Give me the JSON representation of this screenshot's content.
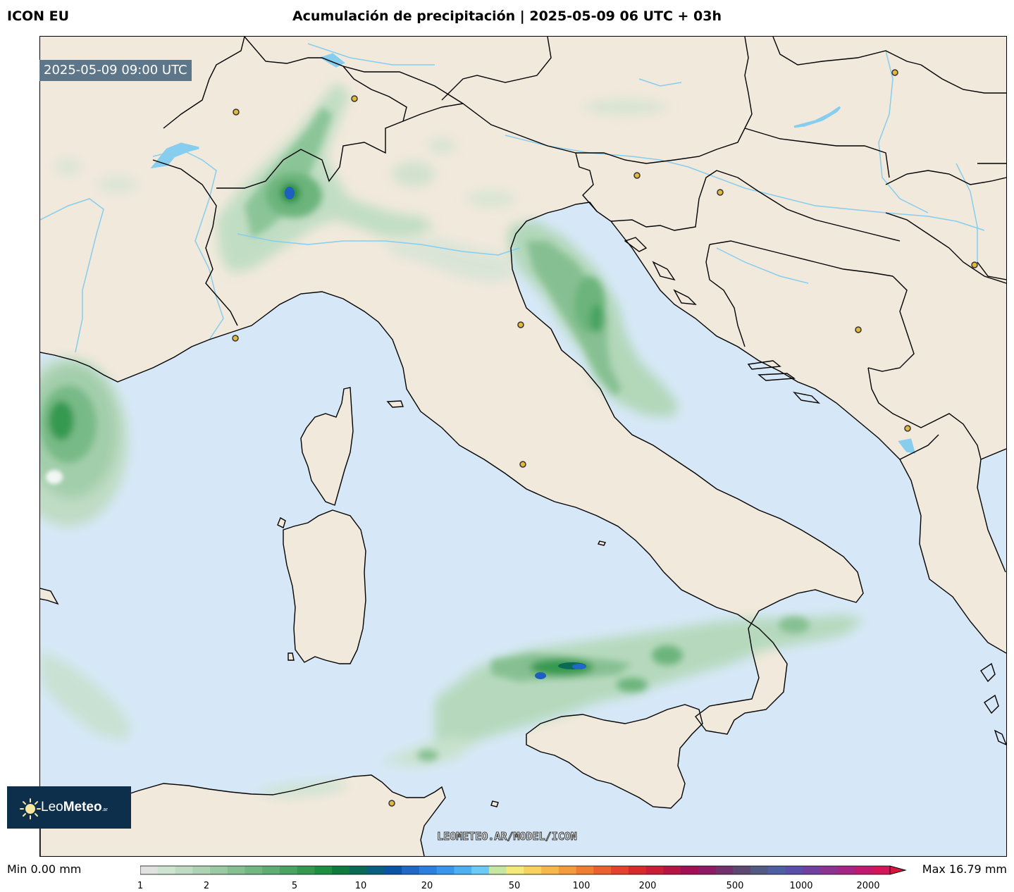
{
  "header": {
    "model": "ICON EU",
    "title": "Acumulación de precipitación | 2025-05-09 06 UTC + 03h"
  },
  "map": {
    "valid_time": "2025-05-09 09:00 UTC",
    "watermark": "LEOMETEO.AR/MODEL/ICON",
    "colors": {
      "sea": "#d6e8f7",
      "land": "#f1e9dc",
      "rivers": "#86cdee",
      "coastline": "#000000",
      "city_marker": "#e2b93b"
    }
  },
  "logo": {
    "name_light": "Leo",
    "name_bold": "Meteo",
    "suffix": ".ar",
    "icon": "sun-icon"
  },
  "legend": {
    "min_label": "Min 0.00 mm",
    "max_label": "Max 16.79 mm",
    "ticks": [
      "1",
      "2",
      "5",
      "10",
      "20",
      "50",
      "100",
      "200",
      "500",
      "1000",
      "2000"
    ],
    "colors": [
      "#dfe2df",
      "#cfe3d1",
      "#bfdcc3",
      "#add3b3",
      "#9acaa3",
      "#86c092",
      "#72b782",
      "#5fad72",
      "#4aa362",
      "#34994f",
      "#1e8e40",
      "#0f7a3d",
      "#0b6a55",
      "#0a5f80",
      "#0a55a3",
      "#1f68c6",
      "#2c7fe0",
      "#3996ec",
      "#4db0f1",
      "#6ccaf4",
      "#c6e6a4",
      "#f4ea7a",
      "#f7d25d",
      "#f6b84b",
      "#f39c3d",
      "#ef7e33",
      "#ea6030",
      "#e3432c",
      "#d72a2b",
      "#c81e36",
      "#b51543",
      "#a10f55",
      "#8c1a66",
      "#73306f",
      "#5d4872",
      "#505a82",
      "#4d5fa0",
      "#5a4fa8",
      "#70409e",
      "#8a3391",
      "#a42584",
      "#bf1a6f",
      "#d3155a"
    ]
  }
}
